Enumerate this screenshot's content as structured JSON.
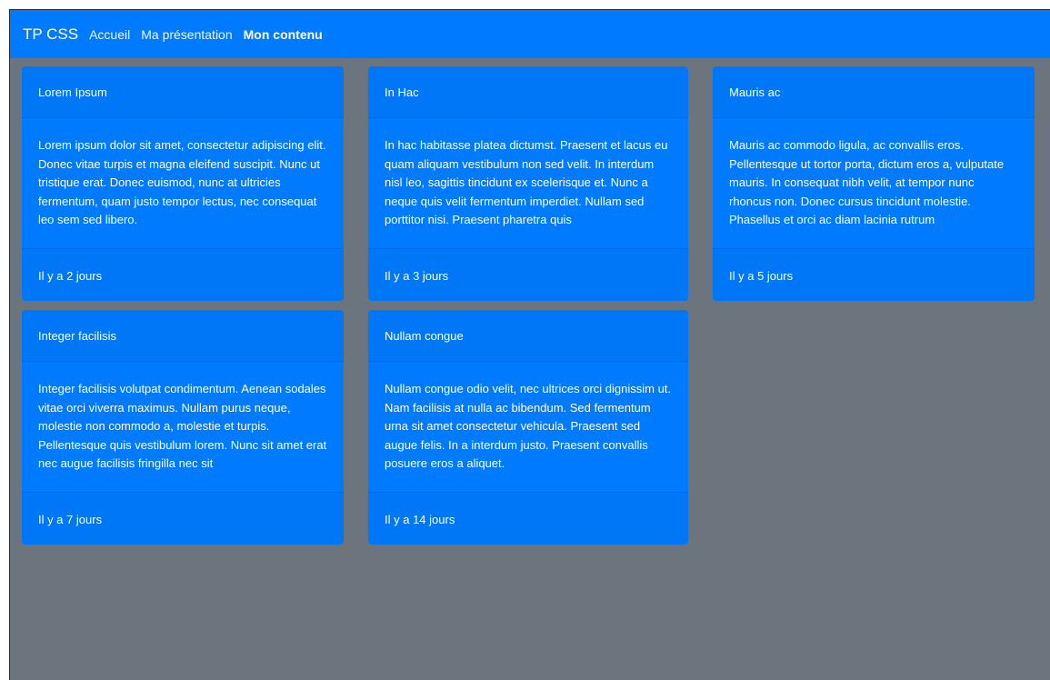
{
  "navbar": {
    "brand": "TP CSS",
    "links": [
      {
        "label": "Accueil",
        "active": false
      },
      {
        "label": "Ma présentation",
        "active": false
      },
      {
        "label": "Mon contenu",
        "active": true
      }
    ]
  },
  "colors": {
    "primary": "#007bff",
    "background": "#6c757d",
    "text": "#ffffff"
  },
  "cards": [
    {
      "title": "Lorem Ipsum",
      "text": "Lorem ipsum dolor sit amet, consectetur adipiscing elit. Donec vitae turpis et magna eleifend suscipit. Nunc ut tristique erat. Donec euismod, nunc at ultricies fermentum, quam justo tempor lectus, nec consequat leo sem sed libero.",
      "footer": "Il y a 2 jours"
    },
    {
      "title": "In Hac",
      "text": "In hac habitasse platea dictumst. Praesent et lacus eu quam aliquam vestibulum non sed velit. In interdum nisl leo, sagittis tincidunt ex scelerisque et. Nunc a neque quis velit fermentum imperdiet. Nullam sed porttitor nisi. Praesent pharetra quis",
      "footer": "Il y a 3 jours"
    },
    {
      "title": "Mauris ac",
      "text": "Mauris ac commodo ligula, ac convallis eros. Pellentesque ut tortor porta, dictum eros a, vulputate mauris. In consequat nibh velit, at tempor nunc rhoncus non. Donec cursus tincidunt molestie. Phasellus et orci ac diam lacinia rutrum",
      "footer": "Il y a 5 jours"
    },
    {
      "title": "Integer facilisis",
      "text": "Integer facilisis volutpat condimentum. Aenean sodales vitae orci viverra maximus. Nullam purus neque, molestie non commodo a, molestie et turpis. Pellentesque quis vestibulum lorem. Nunc sit amet erat nec augue facilisis fringilla nec sit",
      "footer": "Il y a 7 jours"
    },
    {
      "title": "Nullam congue",
      "text": "Nullam congue odio velit, nec ultrices orci dignissim ut. Nam facilisis at nulla ac bibendum. Sed fermentum urna sit amet consectetur vehicula. Praesent sed augue felis. In a interdum justo. Praesent convallis posuere eros a aliquet.",
      "footer": "Il y a 14 jours"
    }
  ]
}
